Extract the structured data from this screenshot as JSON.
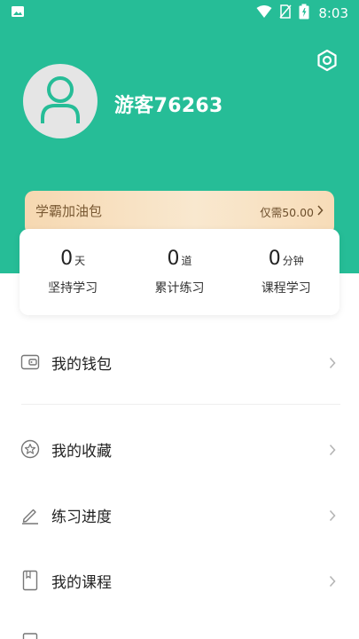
{
  "status_bar": {
    "time": "8:03"
  },
  "header": {
    "username": "游客76263"
  },
  "promo": {
    "title": "学霸加油包",
    "price": "仅需50.00"
  },
  "stats": [
    {
      "value": "0",
      "unit": "天",
      "label": "坚持学习"
    },
    {
      "value": "0",
      "unit": "道",
      "label": "累计练习"
    },
    {
      "value": "0",
      "unit": "分钟",
      "label": "课程学习"
    }
  ],
  "menu": [
    {
      "label": "我的钱包",
      "icon": "wallet-icon"
    },
    {
      "label": "我的收藏",
      "icon": "star-icon"
    },
    {
      "label": "练习进度",
      "icon": "pencil-icon"
    },
    {
      "label": "我的课程",
      "icon": "book-icon"
    }
  ],
  "colors": {
    "primary": "#26bd97",
    "promo_bg": "#f6d8b1",
    "promo_text": "#7a5a34"
  }
}
